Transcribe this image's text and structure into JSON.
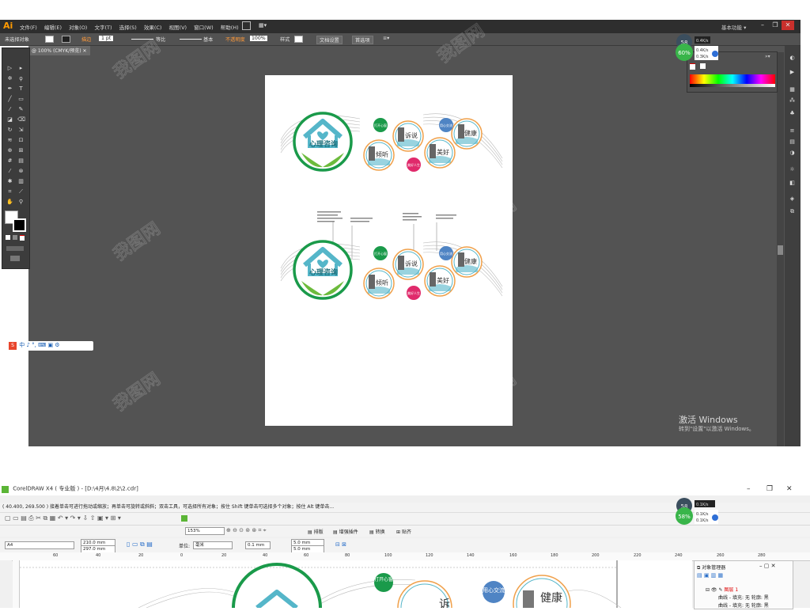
{
  "illustrator": {
    "logo": "Ai",
    "menu": [
      "文件(F)",
      "编辑(E)",
      "对象(O)",
      "文字(T)",
      "选择(S)",
      "效果(C)",
      "视图(V)",
      "窗口(W)",
      "帮助(H)"
    ],
    "workspace": "基本功能",
    "window_buttons": [
      "–",
      "❐",
      "✕"
    ],
    "control_bar": {
      "no_selection": "未选择对象",
      "stroke_label": "描边",
      "stroke_value": "1 pt",
      "stroke_style": "等比",
      "brush": "基本",
      "opacity_label": "不透明度",
      "opacity_value": "100%",
      "style_label": "样式",
      "doc_settings": "文档设置",
      "preferences": "首选项"
    },
    "doc_tab": "@ 100% (CMYK/预览)",
    "ime_bar": "中 ♪ °,",
    "activate_windows": "激活 Windows",
    "activate_hint": "转到\"设置\"以激活 Windows。",
    "net_widget": {
      "percent": "60%",
      "up": "0.4K/s",
      "down": "0.3K/s",
      "label": "58"
    }
  },
  "artwork": {
    "main_title": "心理咨询",
    "circles": [
      "倾听",
      "诉说",
      "美好",
      "健康"
    ],
    "badges": [
      "打开心窗",
      "用心交流",
      "美好人生"
    ],
    "colors": {
      "teal": "#55b6c9",
      "green": "#1a9a4a",
      "leaf": "#6cbb3c",
      "orange": "#f0a04a",
      "pink": "#e02a6b",
      "blue": "#4f84c4"
    }
  },
  "coreldraw": {
    "title": "CorelDRAW X4 ( 专业版 ) - [D:\\4月\\4.8\\2\\2.cdr]",
    "window_buttons": [
      "–",
      "❐",
      "✕"
    ],
    "status": "( 40.400, 269.500 )     接着单击可进行拖动或缩放；再单击可旋转或斜斜；双击工具，可选择所有对象；按住 Shift 键单击可选择多个对象；按住 Alt 键单击...",
    "zoom": "153%",
    "toolbar2_items": [
      "排版",
      "增强插件",
      "转换",
      "贴齐"
    ],
    "page_size": "A4",
    "width": "210.0 mm",
    "height": "297.0 mm",
    "units_label": "单位:",
    "units": "毫米",
    "nudge": "0.1 mm",
    "dup_x": "5.0 mm",
    "dup_y": "5.0 mm",
    "ruler_ticks": [
      "60",
      "40",
      "20",
      "0",
      "20",
      "40",
      "60",
      "80",
      "100",
      "120",
      "140",
      "160",
      "180",
      "200",
      "220",
      "240",
      "260",
      "280"
    ],
    "object_manager": {
      "title": "对象管理器",
      "page": "图层 1",
      "items": [
        "曲线 - 填充: 无 轮廓: 黑",
        "曲线 - 填充: 无 轮廓: 黑"
      ]
    },
    "net_widget": {
      "percent": "58%",
      "up": "0.1K/s",
      "down": "0.1K/s",
      "label": "58"
    },
    "canvas_badges": [
      "打开心窗",
      "用心交流"
    ],
    "canvas_circles": [
      "诉",
      "健康"
    ]
  },
  "watermark": "我图网"
}
